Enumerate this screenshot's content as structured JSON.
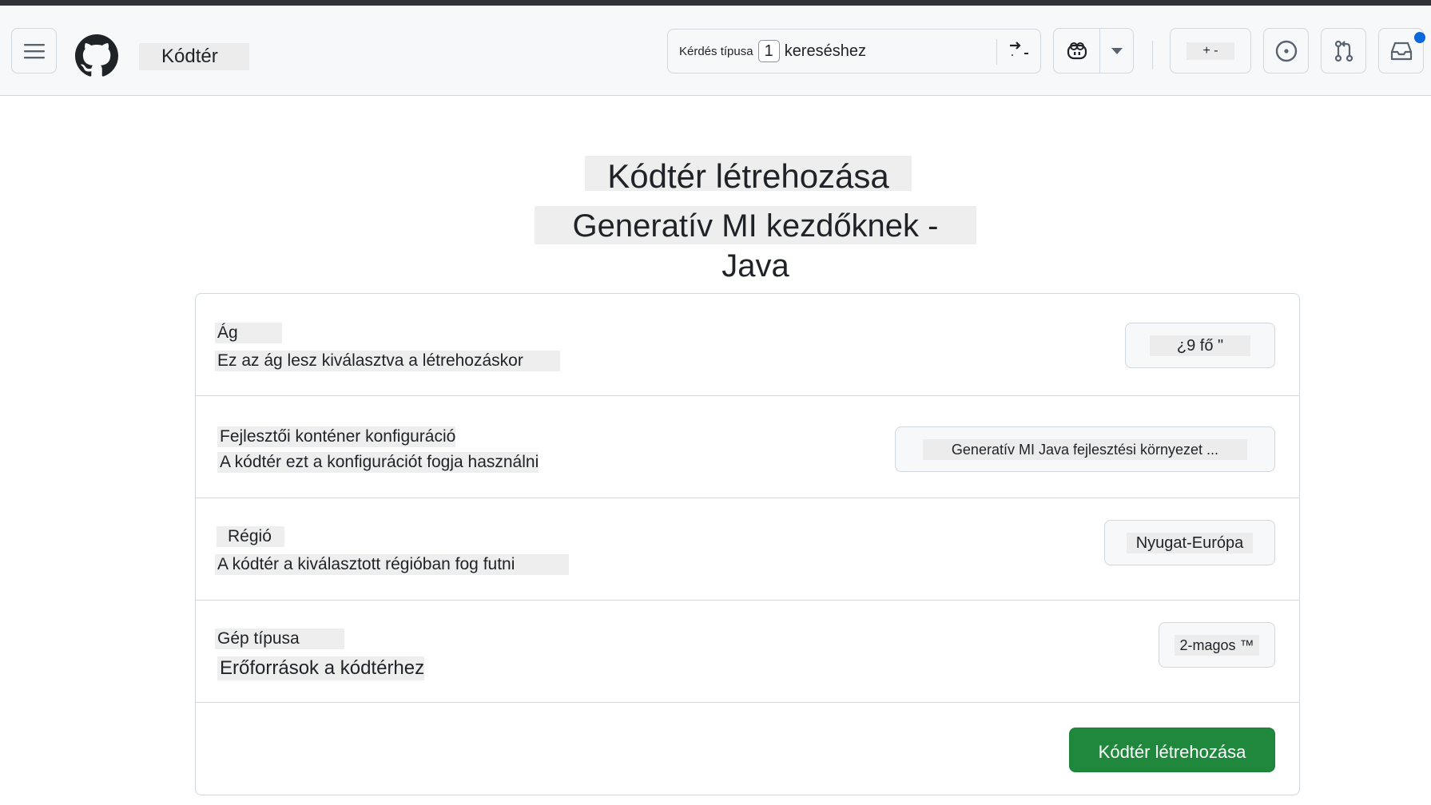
{
  "header": {
    "app_title": "Kódtér",
    "search": {
      "prefix": "Kérdés típusa",
      "key": "1",
      "suffix": "kereséshez"
    },
    "new_label": "+ -",
    "notification_color": "#0969da"
  },
  "main": {
    "title": "Kódtér létrehozása",
    "subtitle": "Generatív MI kezdőknek - Java"
  },
  "form": {
    "rows": [
      {
        "label": "Ág",
        "description": "Ez az ág lesz kiválasztva a létrehozáskor",
        "value": "¿9 fő \""
      },
      {
        "label": "Fejlesztői konténer konfiguráció",
        "description": "A kódtér ezt a konfigurációt fogja használni",
        "value": "Generatív MI Java fejlesztési környezet ..."
      },
      {
        "label": "Régió",
        "description": "A kódtér a kiválasztott régióban fog futni",
        "value": "Nyugat-Európa"
      },
      {
        "label": "Gép típusa",
        "description": "Erőforrások a kódtérhez",
        "value": "2-magos ™"
      }
    ],
    "submit_label": "Kódtér létrehozása",
    "submit_color": "#1f883d"
  },
  "icons": [
    "hamburger-menu-icon",
    "github-logo-icon",
    "command-palette-icon",
    "copilot-icon",
    "chevron-down-icon",
    "issues-icon",
    "pull-request-icon",
    "inbox-icon"
  ]
}
